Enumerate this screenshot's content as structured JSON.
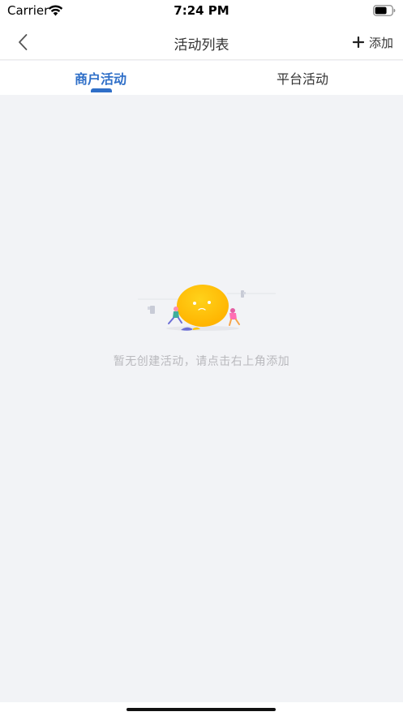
{
  "status_bar": {
    "carrier": "Carrier",
    "time": "7:24 PM",
    "icons": [
      "wifi-icon",
      "battery-icon"
    ]
  },
  "nav": {
    "title": "活动列表",
    "add_label": "添加",
    "back_icon": "chevron-left-icon",
    "add_icon": "plus-icon"
  },
  "tabs": [
    {
      "label": "商户活动",
      "active": true
    },
    {
      "label": "平台活动",
      "active": false
    }
  ],
  "empty_state": {
    "message": "暂无创建活动，请点击右上角添加",
    "illustration": "sad-face-illustration"
  },
  "colors": {
    "accent": "#2f6fc8",
    "background": "#f2f3f6",
    "empty_text": "#b9b9bd",
    "face": "#ffc400"
  }
}
